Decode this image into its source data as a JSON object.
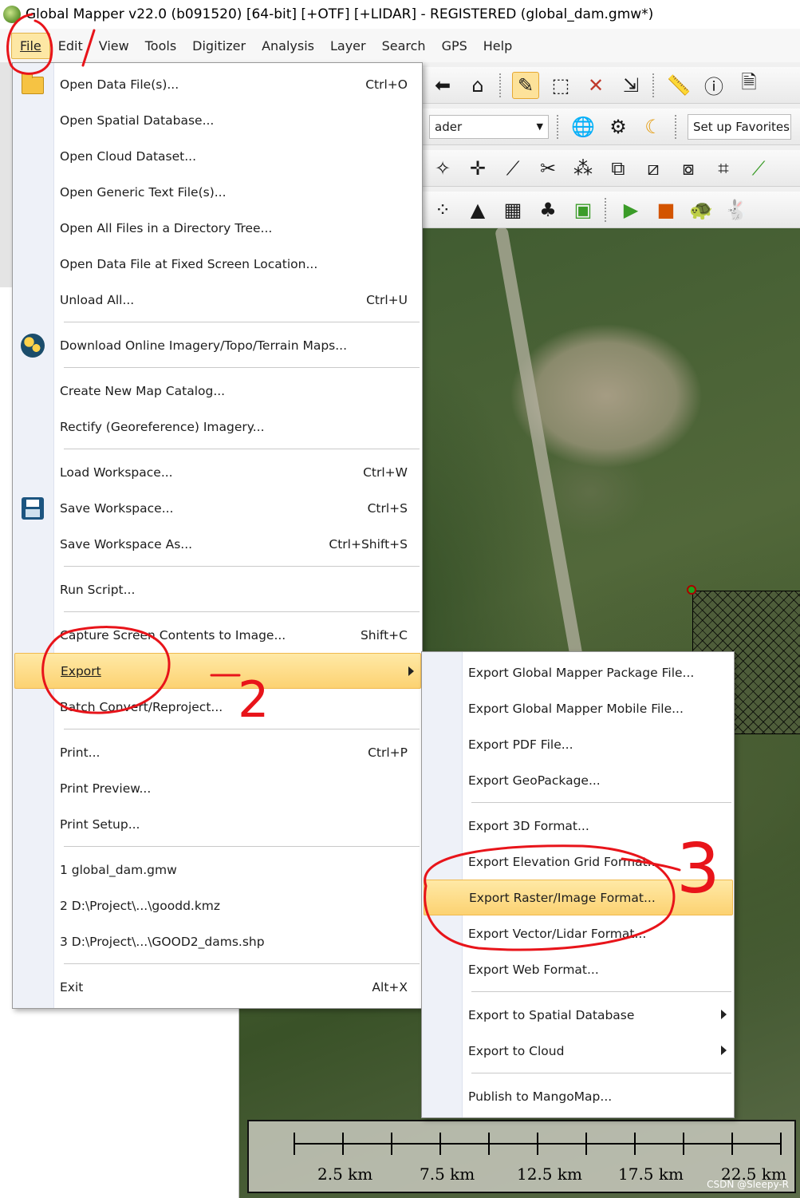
{
  "window": {
    "title": "Global Mapper v22.0 (b091520) [64-bit] [+OTF] [+LIDAR] - REGISTERED (global_dam.gmw*)"
  },
  "menubar": {
    "items": [
      "File",
      "Edit",
      "View",
      "Tools",
      "Digitizer",
      "Analysis",
      "Layer",
      "Search",
      "GPS",
      "Help"
    ]
  },
  "toolbar": {
    "shader_value": "ader",
    "favorites_label": "Set up Favorites"
  },
  "file_menu": {
    "open_data_files": "Open Data File(s)...",
    "open_data_files_shortcut": "Ctrl+O",
    "open_spatial_db": "Open Spatial Database...",
    "open_cloud": "Open Cloud Dataset...",
    "open_generic_text": "Open Generic Text File(s)...",
    "open_dir_tree": "Open All Files in a Directory Tree...",
    "open_fixed_loc": "Open Data File at Fixed Screen Location...",
    "unload_all": "Unload All...",
    "unload_all_shortcut": "Ctrl+U",
    "download_online": "Download Online Imagery/Topo/Terrain Maps...",
    "create_catalog": "Create New Map Catalog...",
    "rectify": "Rectify (Georeference) Imagery...",
    "load_workspace": "Load Workspace...",
    "load_workspace_shortcut": "Ctrl+W",
    "save_workspace": "Save Workspace...",
    "save_workspace_shortcut": "Ctrl+S",
    "save_workspace_as": "Save Workspace As...",
    "save_workspace_as_shortcut": "Ctrl+Shift+S",
    "run_script": "Run Script...",
    "capture_screen": "Capture Screen Contents to Image...",
    "capture_screen_shortcut": "Shift+C",
    "export": "Export",
    "batch_convert": "Batch Convert/Reproject...",
    "print": "Print...",
    "print_shortcut": "Ctrl+P",
    "print_preview": "Print Preview...",
    "print_setup": "Print Setup...",
    "recent_1": "1 global_dam.gmw",
    "recent_2": "2 D:\\Project\\...\\goodd.kmz",
    "recent_3": "3 D:\\Project\\...\\GOOD2_dams.shp",
    "exit": "Exit",
    "exit_shortcut": "Alt+X"
  },
  "export_menu": {
    "package": "Export Global Mapper Package File...",
    "mobile": "Export Global Mapper Mobile File...",
    "pdf": "Export PDF File...",
    "geopackage": "Export GeoPackage...",
    "format_3d": "Export 3D Format...",
    "elevation_grid": "Export Elevation Grid Format...",
    "raster_image": "Export Raster/Image Format...",
    "vector_lidar": "Export Vector/Lidar Format...",
    "web": "Export Web Format...",
    "spatial_db": "Export to Spatial Database",
    "cloud": "Export to Cloud",
    "mangomap": "Publish to MangoMap..."
  },
  "scalebar": {
    "labels": [
      "2.5 km",
      "7.5 km",
      "12.5 km",
      "17.5 km",
      "22.5 km"
    ]
  },
  "watermark": "CSDN @Sleepy-R",
  "annotations": {
    "step2": "2",
    "step3": "3"
  }
}
